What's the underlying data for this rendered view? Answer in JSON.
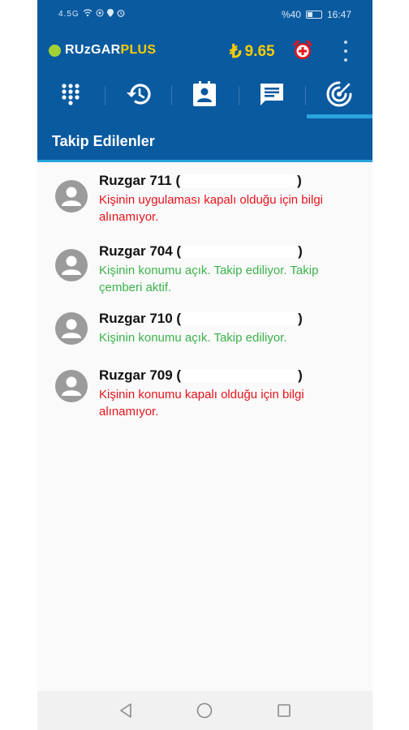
{
  "status_bar": {
    "left_text": "4.5G",
    "battery": "%40",
    "battery_level": 0.4,
    "time": "16:47"
  },
  "app_bar": {
    "logo_part1": "RUzGAR",
    "logo_part2": "PLUS",
    "currency_symbol": "₺",
    "balance": "9.65",
    "alarm_icon": "alarm-add-icon",
    "menu_icon": "more-vert-icon"
  },
  "tabs": [
    {
      "icon": "dialpad-icon",
      "active": false
    },
    {
      "icon": "history-icon",
      "active": false
    },
    {
      "icon": "contacts-icon",
      "active": false
    },
    {
      "icon": "message-icon",
      "active": false
    },
    {
      "icon": "location-track-icon",
      "active": true
    }
  ],
  "section": {
    "title": "Takip Edilenler"
  },
  "followed": [
    {
      "name": "Ruzgar 711 (",
      "name_end": ")",
      "status": "Kişinin uygulaması kapalı olduğu için bilgi alınamıyor.",
      "status_color": "#e8131b"
    },
    {
      "name": "Ruzgar 704 (",
      "name_end": ")",
      "status": "Kişinin konumu açık. Takip ediliyor. Takip çemberi aktif.",
      "status_color": "#3bb24a"
    },
    {
      "name": "Ruzgar 710 (",
      "name_end": ")",
      "status": "Kişinin konumu açık. Takip ediliyor.",
      "status_color": "#3bb24a"
    },
    {
      "name": "Ruzgar 709 (",
      "name_end": ")",
      "status": "Kişinin konumu kapalı olduğu için bilgi alınamıyor.",
      "status_color": "#e8131b"
    }
  ],
  "colors": {
    "primary": "#0a5aa0",
    "accent": "#29a3dd",
    "balance": "#f8cc00",
    "error": "#e8131b",
    "ok": "#3bb24a"
  }
}
